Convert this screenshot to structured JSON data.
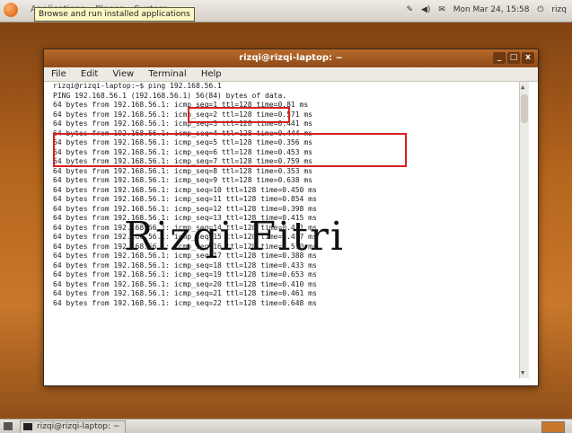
{
  "top_panel": {
    "menus": [
      "Applications",
      "Places",
      "System"
    ],
    "tooltip": "Browse and run installed applications",
    "tray": {
      "clock": "Mon Mar 24, 15:58",
      "user": "rizq"
    }
  },
  "window": {
    "title": "rizqi@rizqi-laptop: ~",
    "menu": [
      "File",
      "Edit",
      "View",
      "Terminal",
      "Help"
    ],
    "controls": [
      "_",
      "□",
      "x"
    ]
  },
  "terminal": {
    "lines": [
      "rizqi@rizqi-laptop:~$ ping 192.168.56.1",
      "PING 192.168.56.1 (192.168.56.1) 56(84) bytes of data.",
      "64 bytes from 192.168.56.1: icmp_seq=1 ttl=128 time=0.81 ms",
      "64 bytes from 192.168.56.1: icmp_seq=2 ttl=128 time=0.571 ms",
      "64 bytes from 192.168.56.1: icmp_seq=3 ttl=128 time=0.441 ms",
      "64 bytes from 192.168.56.1: icmp_seq=4 ttl=128 time=0.444 ms",
      "64 bytes from 192.168.56.1: icmp_seq=5 ttl=128 time=0.356 ms",
      "64 bytes from 192.168.56.1: icmp_seq=6 ttl=128 time=0.453 ms",
      "64 bytes from 192.168.56.1: icmp_seq=7 ttl=128 time=0.759 ms",
      "64 bytes from 192.168.56.1: icmp_seq=8 ttl=128 time=0.353 ms",
      "64 bytes from 192.168.56.1: icmp_seq=9 ttl=128 time=0.638 ms",
      "64 bytes from 192.168.56.1: icmp_seq=10 ttl=128 time=0.450 ms",
      "64 bytes from 192.168.56.1: icmp_seq=11 ttl=128 time=0.854 ms",
      "64 bytes from 192.168.56.1: icmp_seq=12 ttl=128 time=0.398 ms",
      "64 bytes from 192.168.56.1: icmp_seq=13 ttl=128 time=0.415 ms",
      "64 bytes from 192.168.56.1: icmp_seq=14 ttl=128 time=0.431 ms",
      "64 bytes from 192.168.56.1: icmp_seq=15 ttl=128 time=0.457 ms",
      "64 bytes from 192.168.56.1: icmp_seq=16 ttl=128 time=0.510 ms",
      "64 bytes from 192.168.56.1: icmp_seq=17 ttl=128 time=0.388 ms",
      "64 bytes from 192.168.56.1: icmp_seq=18 ttl=128 time=0.433 ms",
      "64 bytes from 192.168.56.1: icmp_seq=19 ttl=128 time=0.653 ms",
      "64 bytes from 192.168.56.1: icmp_seq=20 ttl=128 time=0.410 ms",
      "64 bytes from 192.168.56.1: icmp_seq=21 ttl=128 time=0.461 ms",
      "64 bytes from 192.168.56.1: icmp_seq=22 ttl=128 time=0.648 ms"
    ]
  },
  "watermark": "Rizqi Fitri",
  "taskbar": {
    "task_label": "rizqi@rizqi-laptop: ~"
  },
  "colors": {
    "title_bar": "#9a5220",
    "desktop": "#b5651d",
    "highlight_box": "#d62020"
  }
}
